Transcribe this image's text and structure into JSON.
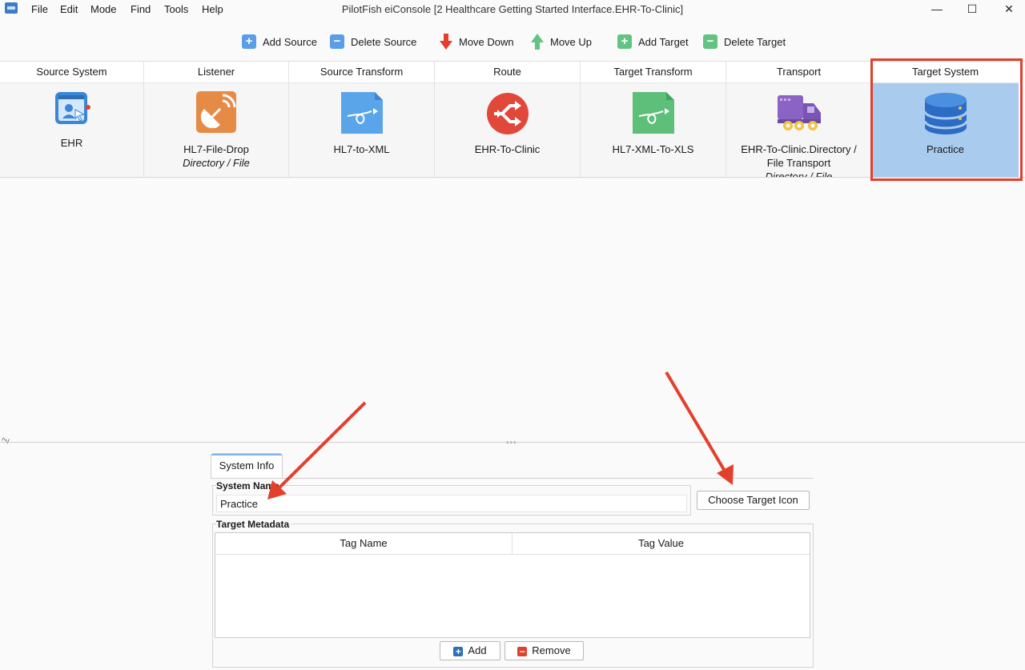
{
  "menu": [
    "File",
    "Edit",
    "Mode",
    "Find",
    "Tools",
    "Help"
  ],
  "window_title": "PilotFish eiConsole [2 Healthcare Getting Started Interface.EHR-To-Clinic]",
  "window_controls": {
    "minimize": "—",
    "maximize": "☐",
    "close": "✕"
  },
  "toolbar": {
    "add_source": "Add Source",
    "delete_source": "Delete Source",
    "move_down": "Move Down",
    "move_up": "Move Up",
    "add_target": "Add Target",
    "delete_target": "Delete Target"
  },
  "stages": [
    {
      "header": "Source System",
      "label": "EHR",
      "sub": ""
    },
    {
      "header": "Listener",
      "label": "HL7-File-Drop",
      "sub": "Directory / File"
    },
    {
      "header": "Source Transform",
      "label": "HL7-to-XML",
      "sub": ""
    },
    {
      "header": "Route",
      "label": "EHR-To-Clinic",
      "sub": ""
    },
    {
      "header": "Target Transform",
      "label": "HL7-XML-To-XLS",
      "sub": ""
    },
    {
      "header": "Transport",
      "label": "EHR-To-Clinic.Directory / File Transport",
      "sub": "Directory / File"
    },
    {
      "header": "Target System",
      "label": "Practice",
      "sub": ""
    }
  ],
  "splitter": {
    "arrows": "^v",
    "dots": "•••"
  },
  "panel": {
    "tab": "System Info",
    "system_name_label": "System Name",
    "system_name_value": "Practice",
    "choose_icon_button": "Choose Target Icon",
    "metadata_label": "Target Metadata",
    "columns": [
      "Tag Name",
      "Tag Value"
    ],
    "add_button": "Add",
    "remove_button": "Remove"
  },
  "colors": {
    "highlight": "#e2402d",
    "selected_stage": "#a9cbee",
    "annotation_arrow": "#e2402d"
  }
}
